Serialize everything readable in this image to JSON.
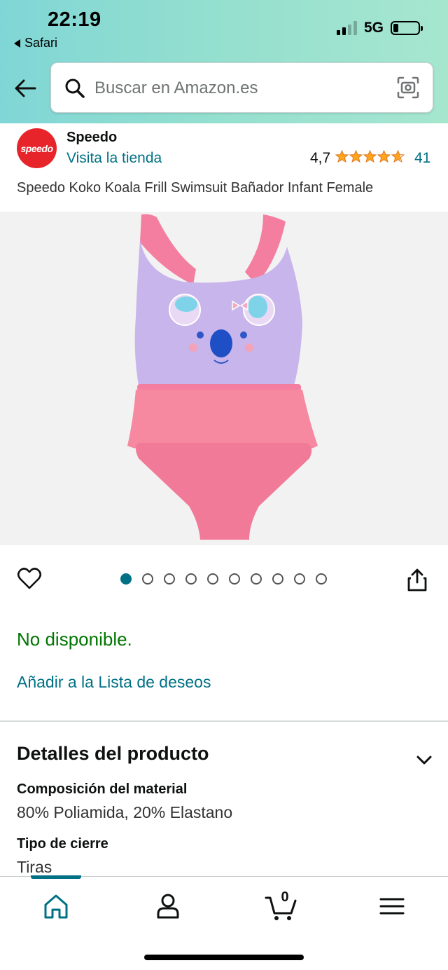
{
  "status_bar": {
    "time": "22:19",
    "back_app": "Safari",
    "network": "5G",
    "battery_percent": 22
  },
  "search": {
    "placeholder": "Buscar en Amazon.es"
  },
  "brand": {
    "name": "Speedo",
    "logo_text": "speedo",
    "store_link": "Visita la tienda"
  },
  "rating": {
    "value": "4,7",
    "stars": 4.7,
    "count": "41"
  },
  "product": {
    "title": "Speedo Koko Koala Frill Swimsuit Bañador Infant Female"
  },
  "gallery": {
    "total_images": 10,
    "active_index": 0
  },
  "availability": {
    "status": "No disponible.",
    "wishlist_link": "Añadir a la Lista de deseos"
  },
  "details": {
    "title": "Detalles del producto",
    "items": [
      {
        "label": "Composición del material",
        "value": "80% Poliamida, 20% Elastano"
      },
      {
        "label": "Tipo de cierre",
        "value": "Tiras"
      }
    ]
  },
  "bottom_nav": {
    "cart_count": "0",
    "items": [
      "home-icon",
      "account-icon",
      "cart-icon",
      "menu-icon"
    ]
  },
  "colors": {
    "accent": "#007185",
    "available_green": "#007600",
    "star": "#FFA41C",
    "header_gradient_start": "#80d6d6",
    "header_gradient_end": "#a6e6cf"
  }
}
